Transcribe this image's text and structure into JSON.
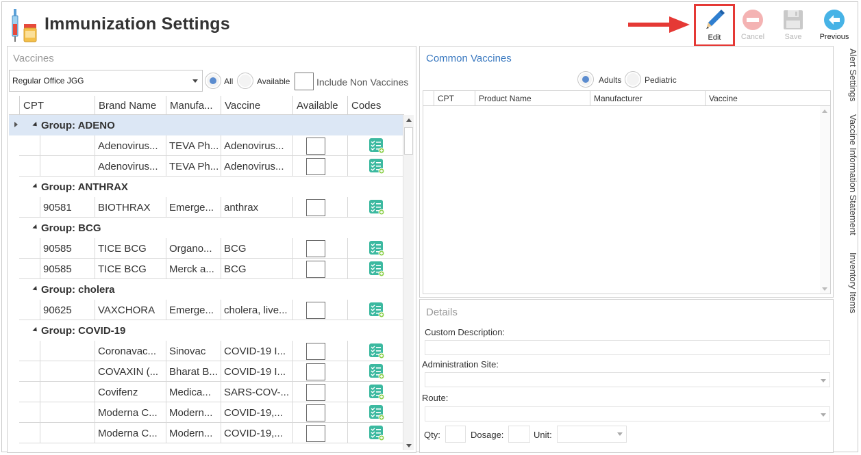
{
  "window": {
    "title": "Immunization Settings"
  },
  "toolbar": {
    "edit_label": "Edit",
    "cancel_label": "Cancel",
    "save_label": "Save",
    "previous_label": "Previous"
  },
  "vaccines": {
    "title": "Vaccines",
    "office_select": "Regular Office JGG",
    "filter_all": "All",
    "filter_available": "Available",
    "include_non_vaccines": "Include Non Vaccines",
    "columns": [
      "CPT",
      "Brand Name",
      "Manufa...",
      "Vaccine",
      "Available",
      "Codes"
    ],
    "groups": [
      {
        "label": "Group: ADENO",
        "rows": [
          {
            "cpt": "",
            "brand": "Adenovirus...",
            "manufacturer": "TEVA Ph...",
            "vaccine": "Adenovirus..."
          },
          {
            "cpt": "",
            "brand": "Adenovirus...",
            "manufacturer": "TEVA Ph...",
            "vaccine": "Adenovirus..."
          }
        ]
      },
      {
        "label": "Group: ANTHRAX",
        "rows": [
          {
            "cpt": "90581",
            "brand": "BIOTHRAX",
            "manufacturer": "Emerge...",
            "vaccine": "anthrax"
          }
        ]
      },
      {
        "label": "Group: BCG",
        "rows": [
          {
            "cpt": "90585",
            "brand": "TICE BCG",
            "manufacturer": "Organo...",
            "vaccine": "BCG"
          },
          {
            "cpt": "90585",
            "brand": "TICE BCG",
            "manufacturer": "Merck a...",
            "vaccine": "BCG"
          }
        ]
      },
      {
        "label": "Group: cholera",
        "rows": [
          {
            "cpt": "90625",
            "brand": "VAXCHORA",
            "manufacturer": "Emerge...",
            "vaccine": "cholera, live..."
          }
        ]
      },
      {
        "label": "Group: COVID-19",
        "rows": [
          {
            "cpt": "",
            "brand": "Coronavac...",
            "manufacturer": "Sinovac",
            "vaccine": "COVID-19 I..."
          },
          {
            "cpt": "",
            "brand": "COVAXIN (...",
            "manufacturer": "Bharat B...",
            "vaccine": "COVID-19 I..."
          },
          {
            "cpt": "",
            "brand": "Covifenz",
            "manufacturer": "Medica...",
            "vaccine": "SARS-COV-..."
          },
          {
            "cpt": "",
            "brand": "Moderna C...",
            "manufacturer": "Modern...",
            "vaccine": "COVID-19,..."
          },
          {
            "cpt": "",
            "brand": "Moderna C...",
            "manufacturer": "Modern...",
            "vaccine": "COVID-19,..."
          }
        ]
      }
    ]
  },
  "common_vaccines": {
    "title": "Common Vaccines",
    "adults": "Adults",
    "pediatric": "Pediatric",
    "columns": [
      "CPT",
      "Product Name",
      "Manufacturer",
      "Vaccine"
    ]
  },
  "details": {
    "title": "Details",
    "custom_description": "Custom Description:",
    "administration_site": "Administration Site:",
    "route": "Route:",
    "qty": "Qty:",
    "dosage": "Dosage:",
    "unit": "Unit:"
  },
  "side_tabs": [
    "Alert Settings",
    "Vaccine Information Statement",
    "Inventory Items"
  ],
  "colors": {
    "accent": "#3a79c0",
    "highlight": "#e53935",
    "codes_icon": "#3cb9a0",
    "group_selected": "#dce7f5"
  }
}
